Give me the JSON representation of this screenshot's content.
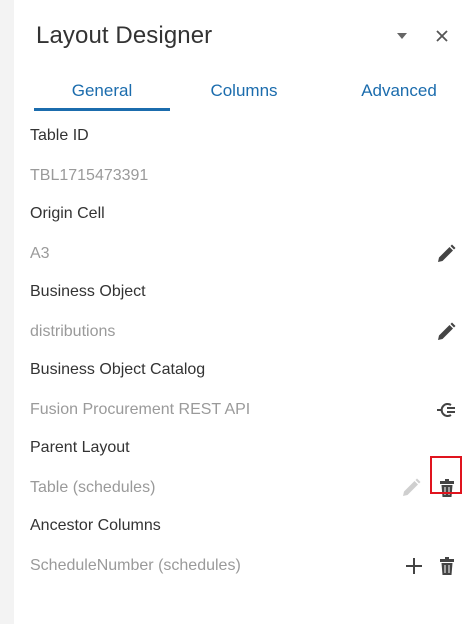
{
  "panel": {
    "title": "Layout Designer",
    "dropdown_icon": "chevron-down-icon",
    "close_label": "✕"
  },
  "tabs": [
    {
      "label": "General",
      "active": true
    },
    {
      "label": "Columns",
      "active": false
    },
    {
      "label": "Advanced",
      "active": false
    }
  ],
  "fields": {
    "table_id": {
      "label": "Table ID",
      "value": "TBL1715473391"
    },
    "origin_cell": {
      "label": "Origin Cell",
      "value": "A3"
    },
    "business_object": {
      "label": "Business Object",
      "value": "distributions"
    },
    "business_object_catalog": {
      "label": "Business Object Catalog",
      "value": "Fusion Procurement REST API"
    },
    "parent_layout": {
      "label": "Parent Layout",
      "value": "Table (schedules)"
    },
    "ancestor_columns": {
      "label": "Ancestor Columns",
      "value": "ScheduleNumber (schedules)"
    }
  },
  "colors": {
    "accent": "#1b6cad",
    "highlight": "#e0141e",
    "value_text": "#9a9a9a"
  }
}
